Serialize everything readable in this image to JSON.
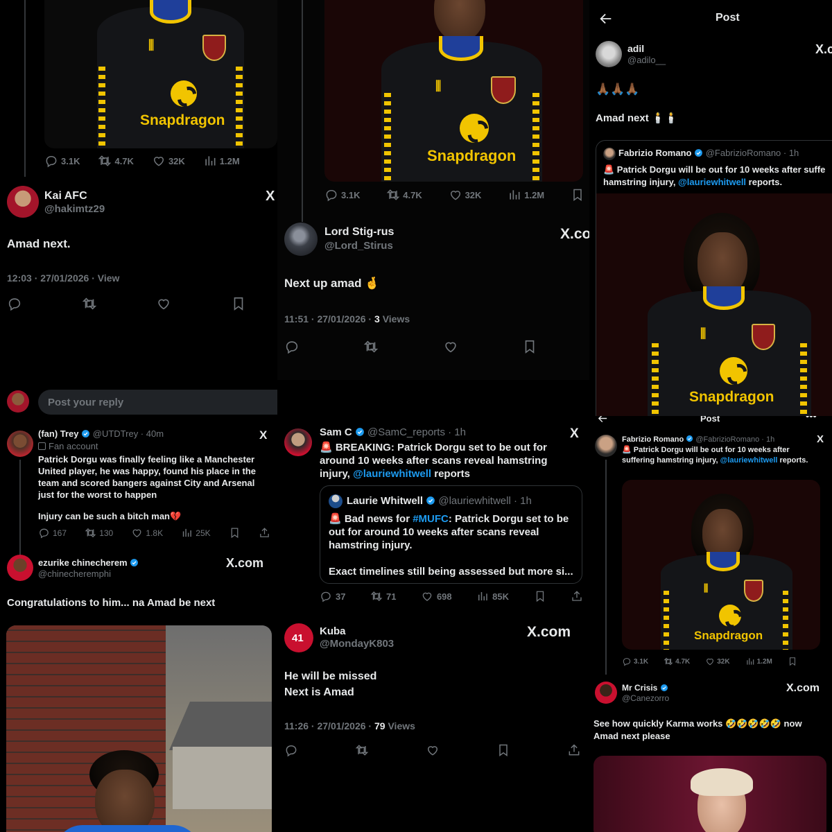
{
  "p1": {
    "stats": {
      "replies": "3.1K",
      "reposts": "4.7K",
      "likes": "32K",
      "views": "1.2M"
    },
    "sponsor": "Snapdragon",
    "name": "Kai AFC",
    "handle": "@hakimtz29",
    "body": "Amad next.",
    "meta": "12:03 · 27/01/2026 · View",
    "x_logo": "X"
  },
  "p2": {
    "stats": {
      "replies": "3.1K",
      "reposts": "4.7K",
      "likes": "32K",
      "views": "1.2M"
    },
    "sponsor": "Snapdragon",
    "name": "Lord Stig-rus",
    "handle": "@Lord_Stirus",
    "body": "Next up amad 🤞",
    "meta_time": "11:51 · 27/01/2026 ·",
    "meta_views_num": "3",
    "meta_views_label": "Views",
    "x_logo": "X.co"
  },
  "p3": {
    "header_title": "Post",
    "name": "adil",
    "handle": "@adilo__",
    "emoji_line": "🙏🏾🙏🏾🙏🏾",
    "body": "Amad next 🕯️🕯️",
    "x_logo": "X.c",
    "quote": {
      "name": "Fabrizio Romano",
      "handle": "@FabrizioRomano · 1h",
      "text": "🚨 Patrick Dorgu will be out for 10 weeks after suffe",
      "text2_pre": "hamstring injury,",
      "text2_link": "@lauriewhitwell",
      "text2_post": "reports."
    },
    "sponsor": "Snapdragon"
  },
  "p4": {
    "reply_placeholder": "Post your reply",
    "trey": {
      "name": "(fan) Trey",
      "handle": "@UTDTrey · 40m",
      "label": "Fan account",
      "body": "Patrick Dorgu was finally feeling like a Manchester United player, he was happy, found his place in the team and scored bangers against City and Arsenal just for the worst to happen",
      "body2": "Injury can be such a bitch man💔",
      "stats": {
        "replies": "167",
        "reposts": "130",
        "likes": "1.8K",
        "views": "25K"
      }
    },
    "ezurike": {
      "name": "ezurike chinecherem",
      "handle": "@chinecheremphi",
      "body": "Congratulations to him... na Amad be next",
      "x_logo": "X.com"
    }
  },
  "p5": {
    "samc": {
      "name": "Sam C",
      "handle": "@SamC_reports · 1h",
      "body_pre": "🚨 BREAKING: Patrick Dorgu set to be out for around 10 weeks after scans reveal hamstring injury,",
      "body_link": "@lauriewhitwell",
      "body_post": "reports",
      "stats": {
        "replies": "37",
        "reposts": "71",
        "likes": "698",
        "views": "85K"
      }
    },
    "quote": {
      "name": "Laurie Whitwell",
      "handle": "@lauriewhitwell · 1h",
      "text_pre": "🚨 Bad news for",
      "text_tag": "#MUFC",
      "text_post": ": Patrick Dorgu set to be out for around 10 weeks after scans reveal hamstring injury.",
      "text2": "Exact timelines still being assessed but more si..."
    },
    "kuba": {
      "name": "Kuba",
      "handle": "@MondayK803",
      "shirt_number": "41",
      "line1": "He will be missed",
      "line2": "Next is Amad",
      "meta_time": "11:26 · 27/01/2026 ·",
      "meta_views_num": "79",
      "meta_views_label": "Views",
      "x_logo": "X.com"
    }
  },
  "p6": {
    "header_title": "Post",
    "fab": {
      "name": "Fabrizio Romano",
      "handle": "@FabrizioRomano · 1h",
      "body_pre": "🚨 Patrick Dorgu will be out for 10 weeks after suffering hamstring injury,",
      "body_link": "@lauriewhitwell",
      "body_post": "reports.",
      "stats": {
        "replies": "3.1K",
        "reposts": "4.7K",
        "likes": "32K",
        "views": "1.2M"
      },
      "sponsor": "Snapdragon"
    },
    "crisis": {
      "name": "Mr Crisis",
      "handle": "@Canezorro",
      "x_logo": "X.com",
      "line1": "See how quickly Karma works 🤣🤣🤣🤣🤣 now",
      "line2": "Amad next please"
    }
  },
  "colors": {
    "link": "#1d9bf0",
    "muted": "#71767b",
    "jersey_trim": "#f1c400",
    "verified": "#1d9bf0"
  }
}
